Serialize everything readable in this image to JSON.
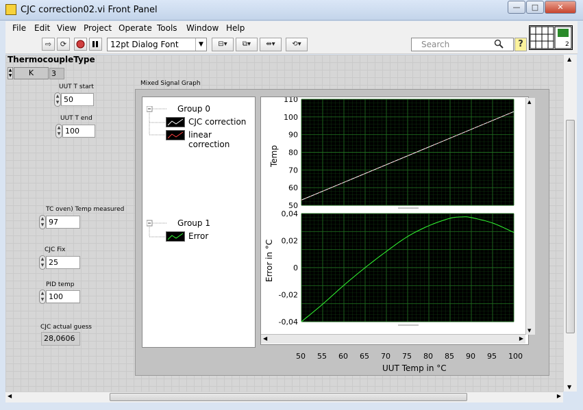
{
  "window": {
    "title": "CJC correction02.vi Front Panel",
    "minimize": "—",
    "maximize": "□",
    "close": "✕"
  },
  "menu": [
    "File",
    "Edit",
    "View",
    "Project",
    "Operate",
    "Tools",
    "Window",
    "Help"
  ],
  "toolbar": {
    "font": "12pt Dialog Font",
    "search_placeholder": "Search",
    "help": "?"
  },
  "controls": {
    "tc_type_label": "ThermocoupleType",
    "tc_type_value": "K",
    "tc_type_index": "3",
    "uut_t_start_label": "UUT T start",
    "uut_t_start": "50",
    "uut_t_end_label": "UUT T end",
    "uut_t_end": "100",
    "tc_oven_label": "TC  oven) Temp measured",
    "tc_oven": "97",
    "cjc_fix_label": "CJC Fix",
    "cjc_fix": "25",
    "pid_temp_label": "PID temp",
    "pid_temp": "100",
    "cjc_actual_label": "CJC actual guess",
    "cjc_actual": "28,0606"
  },
  "graph": {
    "label": "Mixed Signal Graph",
    "legend": {
      "group0": "Group 0",
      "group0_items": [
        "CJC correction",
        "linear correction"
      ],
      "group1": "Group 1",
      "group1_items": [
        "Error"
      ]
    },
    "colors": {
      "background": "#000000",
      "grid": "#1f6b1f",
      "cjc": "#ffffff",
      "linear": "#ff4040",
      "error": "#33ff33"
    }
  },
  "chart_data": [
    {
      "type": "line",
      "ylabel": "Temp",
      "ylim": [
        50,
        110
      ],
      "yticks": [
        "110",
        "100",
        "90",
        "80",
        "70",
        "60",
        "50"
      ],
      "xlim": [
        50,
        100
      ],
      "series": [
        {
          "name": "CJC correction",
          "x": [
            50,
            100
          ],
          "y": [
            53,
            103
          ]
        },
        {
          "name": "linear correction",
          "x": [
            50,
            100
          ],
          "y": [
            53,
            103
          ]
        }
      ]
    },
    {
      "type": "line",
      "ylabel": "Error in °C",
      "ylim": [
        -0.04,
        0.04
      ],
      "yticks": [
        "0,04",
        "0,02",
        "0",
        "-0,02",
        "-0,04"
      ],
      "xlabel": "UUT Temp in °C",
      "xticks": [
        "50",
        "55",
        "60",
        "65",
        "70",
        "75",
        "80",
        "85",
        "90",
        "95",
        "100"
      ],
      "xlim": [
        50,
        100
      ],
      "series": [
        {
          "name": "Error",
          "x": [
            50,
            55,
            60,
            65,
            70,
            75,
            80,
            85,
            88,
            90,
            95,
            100
          ],
          "y": [
            -0.04,
            -0.027,
            -0.013,
            0.0,
            0.012,
            0.023,
            0.031,
            0.0365,
            0.0375,
            0.037,
            0.033,
            0.026
          ]
        }
      ]
    }
  ]
}
